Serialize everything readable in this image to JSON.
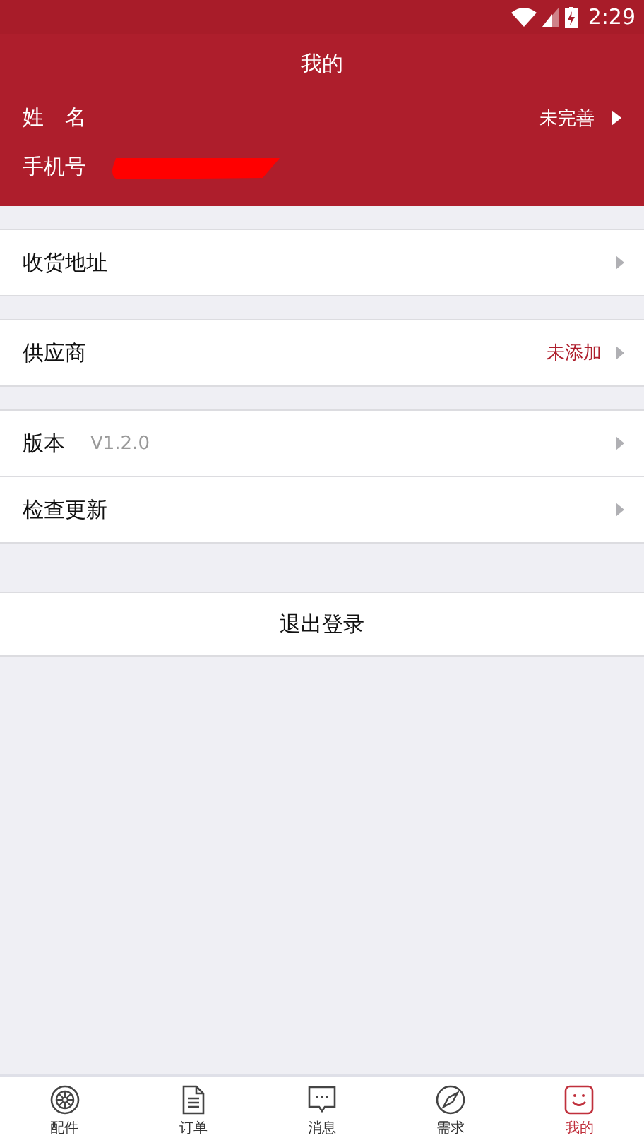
{
  "status_bar": {
    "time": "2:29"
  },
  "header": {
    "title": "我的"
  },
  "profile": [
    {
      "label": "姓　名",
      "value": "未完善",
      "arrow": true
    },
    {
      "label": "手机号",
      "redacted": true
    }
  ],
  "groups": [
    [
      {
        "label": "收货地址"
      }
    ],
    [
      {
        "label": "供应商",
        "value": "未添加"
      }
    ],
    [
      {
        "label": "版本",
        "note": "V1.2.0"
      },
      {
        "label": "检查更新"
      }
    ]
  ],
  "logout": {
    "label": "退出登录"
  },
  "tabs": [
    {
      "label": "配件",
      "selected": false
    },
    {
      "label": "订单",
      "selected": false
    },
    {
      "label": "消息",
      "selected": false
    },
    {
      "label": "需求",
      "selected": false
    },
    {
      "label": "我的",
      "selected": true
    }
  ]
}
